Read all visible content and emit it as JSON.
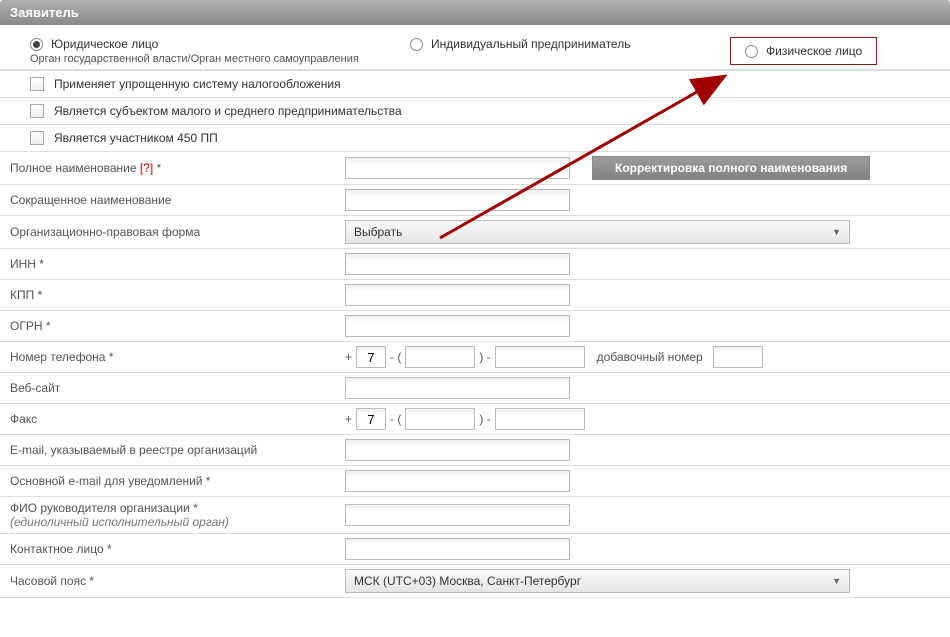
{
  "header": {
    "title": "Заявитель"
  },
  "radios": {
    "legal": "Юридическое лицо",
    "legal_sub": "Орган государственной власти/Орган местного самоуправления",
    "individual": "Индивидуальный предприниматель",
    "physical": "Физическое лицо",
    "selected": "legal"
  },
  "checkboxes": {
    "simplified": "Применяет упрощенную систему налогообложения",
    "sme": "Является субъектом малого и среднего предпринимательства",
    "pp450": "Является участником 450 ПП"
  },
  "fields": {
    "full_name_label": "Полное наименование ",
    "full_name_help": "[?]",
    "short_name_label": "Сокращенное наименование",
    "legal_form_label": "Организационно-правовая форма",
    "legal_form_placeholder": "Выбрать",
    "inn_label": "ИНН *",
    "kpp_label": "КПП *",
    "ogrn_label": "ОГРН *",
    "phone_label": "Номер телефона *",
    "phone_prefix": "+",
    "phone_cc": "7",
    "phone_sep1": "- (",
    "phone_sep2": ") -",
    "ext_label": "добавочный номер",
    "website_label": "Веб-сайт",
    "fax_label": "Факс",
    "fax_cc": "7",
    "email_reg_label": "E-mail, указываемый в реестре организаций",
    "email_main_label": "Основной e-mail для уведомлений *",
    "fio_label": "ФИО руководителя организации *",
    "fio_sub": "(единоличный исполнительный орган)",
    "contact_label": "Контактное лицо *",
    "tz_label": "Часовой пояс *",
    "tz_value": "МСК (UTC+03) Москва, Санкт-Петербург",
    "correct_btn": "Корректировка полного наименования",
    "req": " *"
  }
}
